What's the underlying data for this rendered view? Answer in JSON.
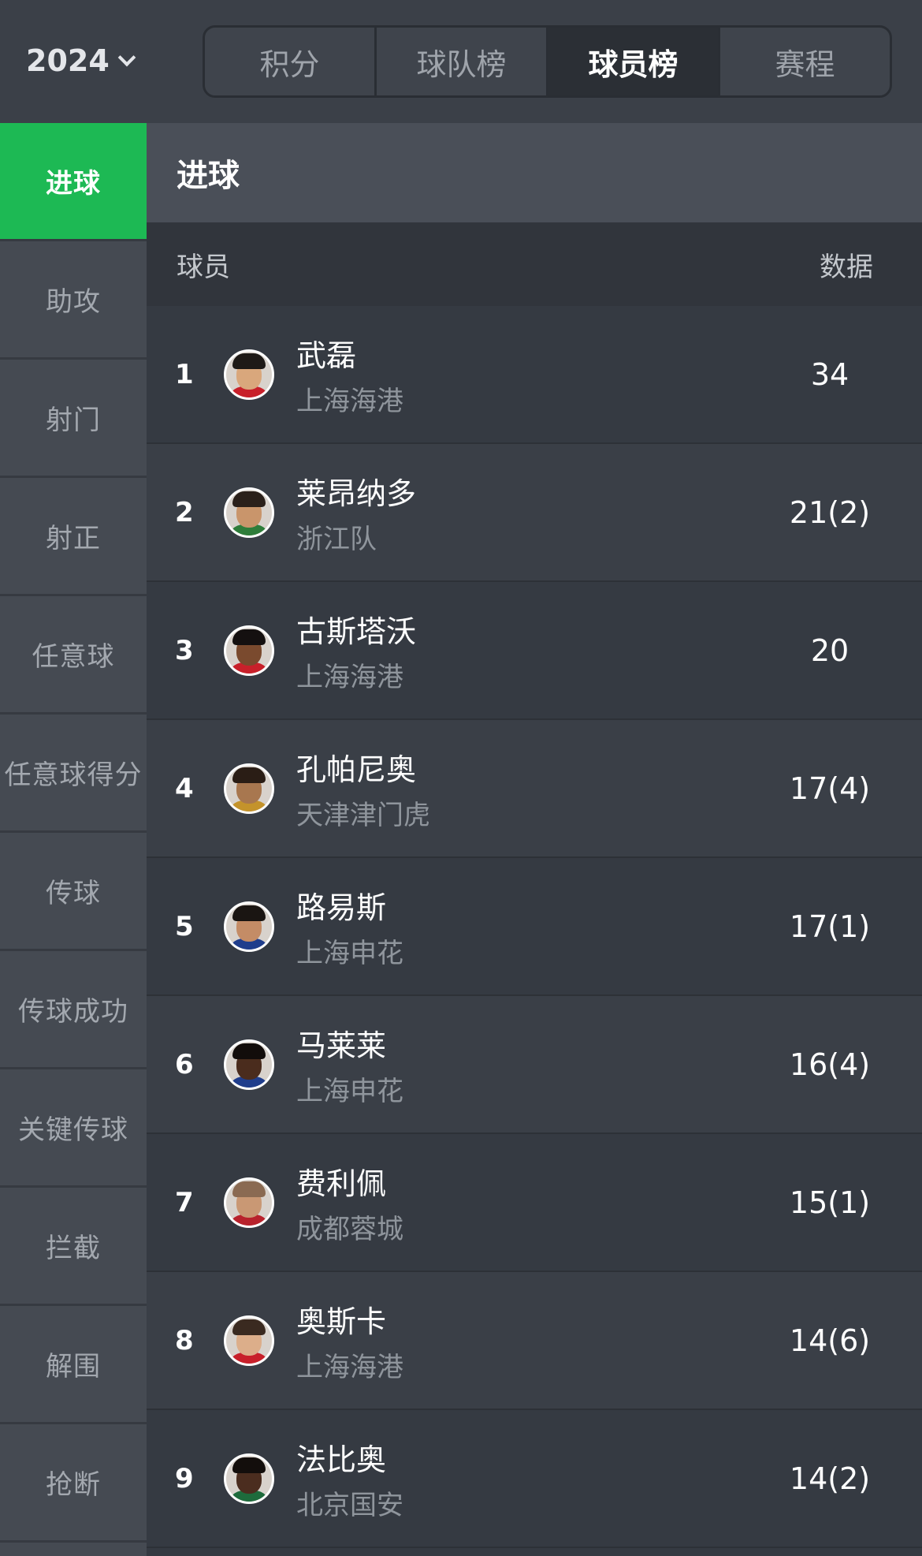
{
  "header": {
    "year": "2024",
    "tabs": [
      {
        "label": "积分"
      },
      {
        "label": "球队榜"
      },
      {
        "label": "球员榜"
      },
      {
        "label": "赛程"
      }
    ],
    "active_tab": "球员榜"
  },
  "sidebar": {
    "items": [
      {
        "label": "进球"
      },
      {
        "label": "助攻"
      },
      {
        "label": "射门"
      },
      {
        "label": "射正"
      },
      {
        "label": "任意球"
      },
      {
        "label": "任意球得分"
      },
      {
        "label": "传球"
      },
      {
        "label": "传球成功"
      },
      {
        "label": "关键传球"
      },
      {
        "label": "拦截"
      },
      {
        "label": "解围"
      },
      {
        "label": "抢断"
      }
    ],
    "active": "进球"
  },
  "main": {
    "title": "进球",
    "columns": {
      "player": "球员",
      "stat": "数据"
    },
    "rows": [
      {
        "rank": "1",
        "name": "武磊",
        "team": "上海海港",
        "value": "34"
      },
      {
        "rank": "2",
        "name": "莱昂纳多",
        "team": "浙江队",
        "value": "21(2)"
      },
      {
        "rank": "3",
        "name": "古斯塔沃",
        "team": "上海海港",
        "value": "20"
      },
      {
        "rank": "4",
        "name": "孔帕尼奥",
        "team": "天津津门虎",
        "value": "17(4)"
      },
      {
        "rank": "5",
        "name": "路易斯",
        "team": "上海申花",
        "value": "17(1)"
      },
      {
        "rank": "6",
        "name": "马莱莱",
        "team": "上海申花",
        "value": "16(4)"
      },
      {
        "rank": "7",
        "name": "费利佩",
        "team": "成都蓉城",
        "value": "15(1)"
      },
      {
        "rank": "8",
        "name": "奥斯卡",
        "team": "上海海港",
        "value": "14(6)"
      },
      {
        "rank": "9",
        "name": "法比奥",
        "team": "北京国安",
        "value": "14(2)"
      }
    ]
  },
  "colors": {
    "accent": "#1db954",
    "background": "#353a42",
    "sidebar": "#454a52",
    "header": "#3b4048"
  },
  "icons": {
    "year_dropdown": "chevron-down-icon",
    "player_avatar": "avatar-photo"
  }
}
